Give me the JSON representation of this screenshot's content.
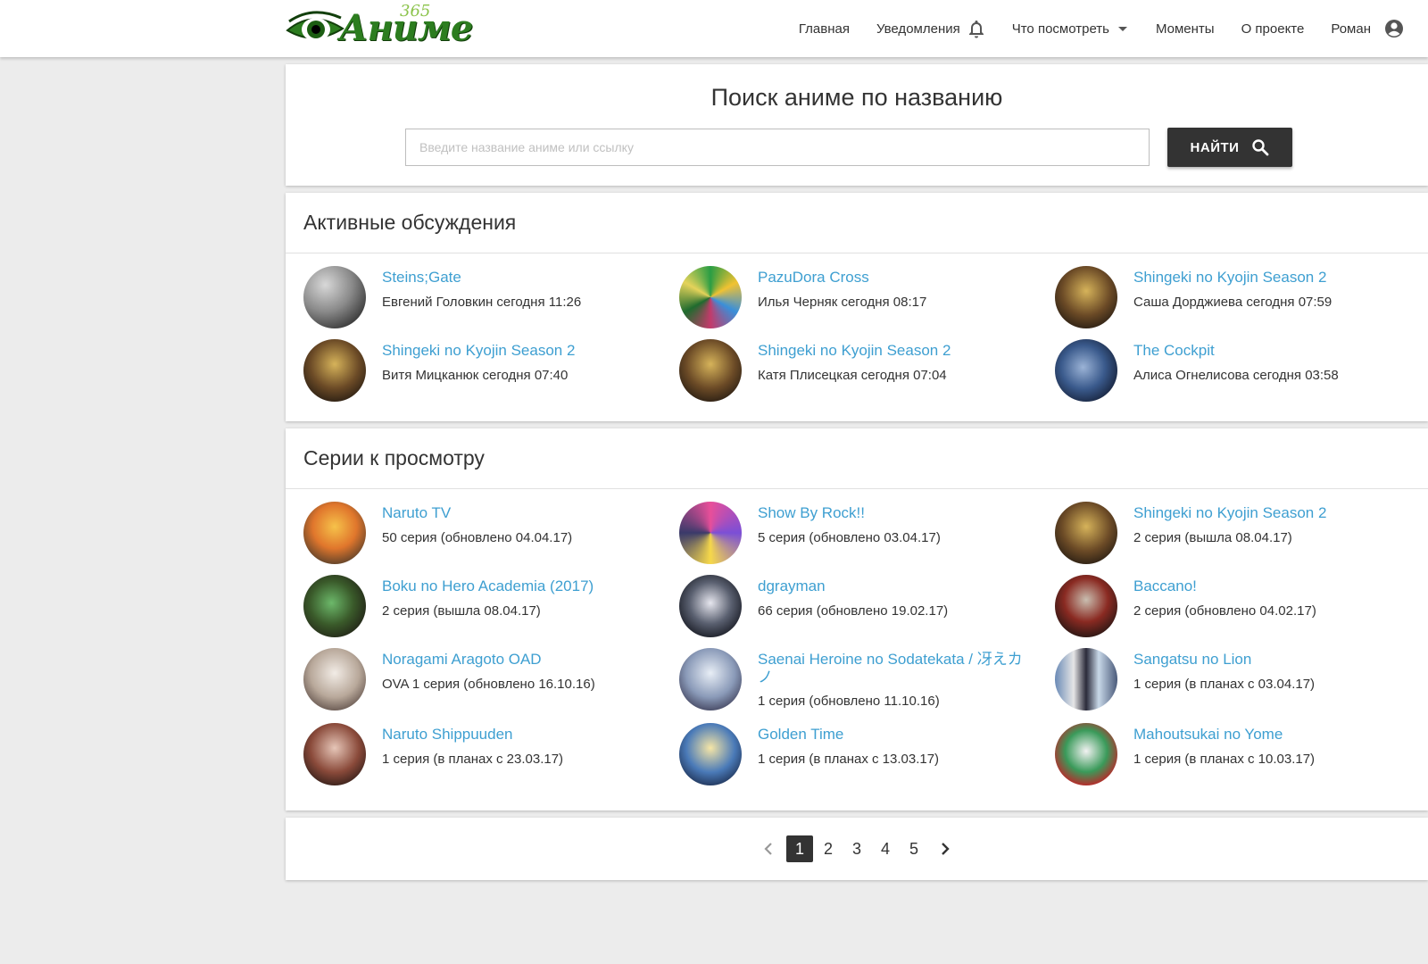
{
  "header": {
    "logo_text": "Аниме",
    "logo_number": "365",
    "nav": [
      {
        "label": "Главная"
      },
      {
        "label": "Уведомления",
        "icon": "bell-icon"
      },
      {
        "label": "Что посмотреть",
        "icon": "caret-down-icon"
      },
      {
        "label": "Моменты"
      },
      {
        "label": "О проекте"
      },
      {
        "label": "Роман",
        "icon": "account-circle-icon"
      }
    ]
  },
  "search": {
    "title": "Поиск аниме по названию",
    "placeholder": "Введите название аниме или ссылку",
    "value": "",
    "button_label": "НАЙТИ",
    "button_icon": "search-icon"
  },
  "discussions": {
    "title": "Активные обсуждения",
    "items": [
      {
        "title": "Steins;Gate",
        "subtitle": "Евгений Головкин сегодня 11:26"
      },
      {
        "title": "PazuDora Cross",
        "subtitle": "Илья Черняк сегодня 08:17"
      },
      {
        "title": "Shingeki no Kyojin Season 2",
        "subtitle": "Саша Дорджиева сегодня 07:59"
      },
      {
        "title": "Shingeki no Kyojin Season 2",
        "subtitle": "Витя Мицканюк сегодня 07:40"
      },
      {
        "title": "Shingeki no Kyojin Season 2",
        "subtitle": "Катя Плисецкая сегодня 07:04"
      },
      {
        "title": "The Cockpit",
        "subtitle": "Алиса Огнелисова сегодня 03:58"
      }
    ]
  },
  "episodes": {
    "title": "Серии к просмотру",
    "items": [
      {
        "title": "Naruto TV",
        "subtitle": "50 серия (обновлено 04.04.17)"
      },
      {
        "title": "Show By Rock!!",
        "subtitle": "5 серия (обновлено 03.04.17)"
      },
      {
        "title": "Shingeki no Kyojin Season 2",
        "subtitle": "2 серия (вышла 08.04.17)"
      },
      {
        "title": "Boku no Hero Academia (2017)",
        "subtitle": "2 серия (вышла 08.04.17)"
      },
      {
        "title": "dgrayman",
        "subtitle": "66 серия (обновлено 19.02.17)"
      },
      {
        "title": "Baccano!",
        "subtitle": "2 серия (обновлено 04.02.17)"
      },
      {
        "title": "Noragami Aragoto OAD",
        "subtitle": "OVA 1 серия (обновлено 16.10.16)"
      },
      {
        "title": "Saenai Heroine no Sodatekata / 冴えカノ",
        "subtitle": "1 серия (обновлено 11.10.16)"
      },
      {
        "title": "Sangatsu no Lion",
        "subtitle": "1 серия (в планах с 03.04.17)"
      },
      {
        "title": "Naruto Shippuuden",
        "subtitle": "1 серия (в планах с 23.03.17)"
      },
      {
        "title": "Golden Time",
        "subtitle": "1 серия (в планах с 13.03.17)"
      },
      {
        "title": "Mahoutsukai no Yome",
        "subtitle": "1 серия (в планах с 10.03.17)"
      }
    ]
  },
  "pagination": {
    "pages": [
      "1",
      "2",
      "3",
      "4",
      "5"
    ],
    "current": "1"
  },
  "colors": {
    "accent_link": "#3e9fd1",
    "dark_button": "#333333",
    "page_background": "#ececec",
    "logo_green": "#2c7d1f"
  }
}
